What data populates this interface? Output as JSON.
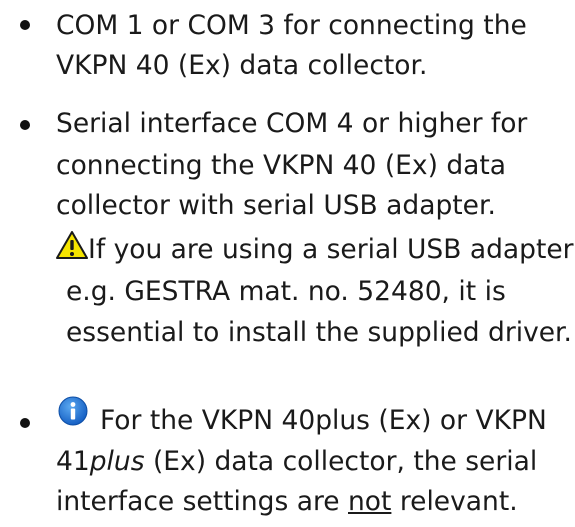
{
  "list": {
    "item1": {
      "line1": "COM 1 or COM 3 for connecting the",
      "line2": "VKPN 40 (Ex) data collector."
    },
    "item2": {
      "line1": "Serial interface COM 4 or higher for",
      "line2": "connecting the VKPN 40 (Ex) data",
      "line3": "collector with serial USB adapter.",
      "warning": {
        "icon": "warning-icon",
        "line1": "If you are using a serial USB adapter,",
        "line2": "e.g. GESTRA mat. no. 52480, it is",
        "line3": "essential to install the supplied driver."
      }
    },
    "item3": {
      "icon": "info-icon",
      "line1": "For the VKPN 40plus (Ex) or VKPN",
      "line2_prefix": "41",
      "line2_italic": "plus",
      "line2_suffix": " (Ex) data collector, the serial",
      "line3_prefix": "interface settings are ",
      "line3_underline": "not",
      "line3_suffix": " relevant."
    }
  }
}
